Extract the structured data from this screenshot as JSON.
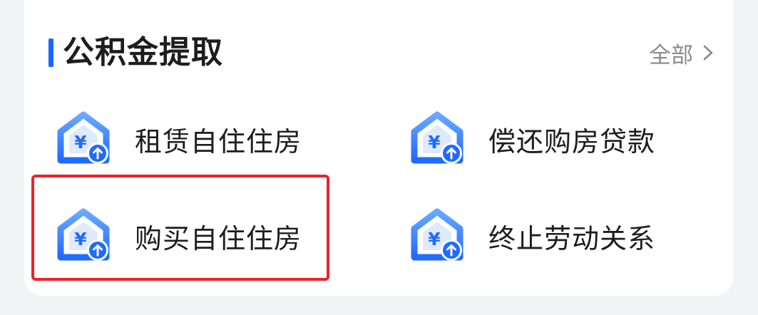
{
  "section": {
    "title": "公积金提取",
    "view_all_label": "全部",
    "accent_color": "#1a66ff"
  },
  "items": [
    {
      "label": "租赁自住住房",
      "icon": "house-yuan-upload-icon"
    },
    {
      "label": "偿还购房贷款",
      "icon": "house-yuan-upload-icon"
    },
    {
      "label": "购买自住住房",
      "icon": "house-yuan-upload-icon"
    },
    {
      "label": "终止劳动关系",
      "icon": "house-yuan-upload-icon"
    }
  ],
  "highlight": {
    "target": "购买自住住房",
    "color": "#e8242b"
  },
  "icon_symbol": "¥"
}
